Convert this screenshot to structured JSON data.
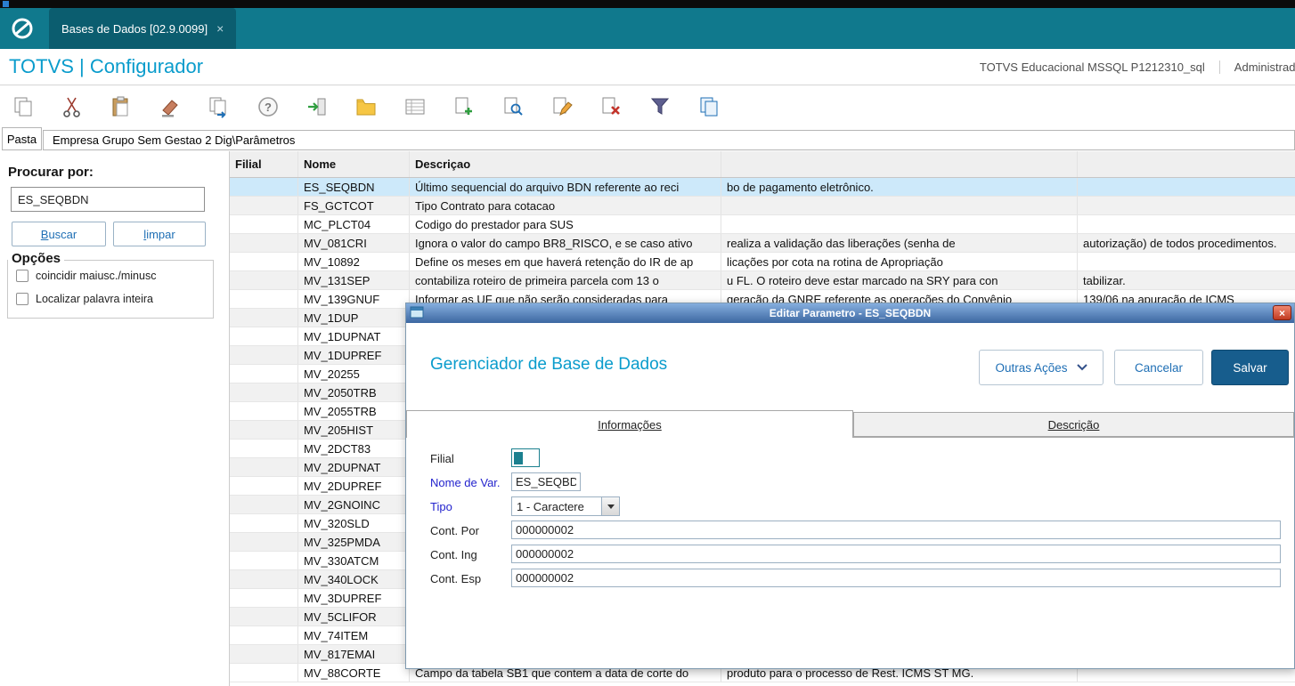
{
  "window": {
    "tab_title": "Bases de Dados [02.9.0099]",
    "tab_close": "×"
  },
  "header": {
    "title": "TOTVS | Configurador",
    "environment": "TOTVS Educacional MSSQL P1212310_sql",
    "user": "Administrador"
  },
  "toolbar": {
    "icons": [
      "copy",
      "cut",
      "paste",
      "eraser",
      "send",
      "help",
      "enter",
      "folder",
      "table",
      "add-record",
      "view",
      "edit",
      "delete-record",
      "filter",
      "duplicate"
    ]
  },
  "pasta": {
    "label": "Pasta",
    "path": "Empresa Grupo Sem Gestao 2 Dig\\Parâmetros"
  },
  "search_panel": {
    "title": "Procurar por:",
    "value": "ES_SEQBDN",
    "buscar": "Buscar",
    "limpar": "limpar",
    "options_title": "Opções",
    "options": [
      {
        "label": "coincidir maiusc./minusc",
        "checked": false
      },
      {
        "label": "Localizar palavra inteira",
        "checked": false
      }
    ]
  },
  "table": {
    "columns": [
      "Filial",
      "Nome",
      "Descriçao"
    ],
    "rows": [
      {
        "filial": "",
        "nome": "ES_SEQBDN",
        "d1": "Último sequencial do arquivo BDN referente ao reci",
        "d2": "bo de pagamento eletrônico.",
        "d3": "",
        "selected": true
      },
      {
        "filial": "",
        "nome": "FS_GCTCOT",
        "d1": "Tipo Contrato para cotacao",
        "d2": "",
        "d3": ""
      },
      {
        "filial": "",
        "nome": "MC_PLCT04",
        "d1": "Codigo do prestador para SUS",
        "d2": "",
        "d3": ""
      },
      {
        "filial": "",
        "nome": "MV_081CRI",
        "d1": "Ignora o valor do campo BR8_RISCO, e se caso ativo",
        "d2": "realiza a validação das liberações (senha de",
        "d3": "autorização) de todos procedimentos."
      },
      {
        "filial": "",
        "nome": "MV_10892",
        "d1": "Define os meses em que haverá retenção do IR de ap",
        "d2": "licações por cota na rotina de Apropriação",
        "d3": ""
      },
      {
        "filial": "",
        "nome": "MV_131SEP",
        "d1": "contabiliza roteiro de primeira parcela com 13 o",
        "d2": "u FL. O roteiro deve estar marcado na SRY para con",
        "d3": "tabilizar."
      },
      {
        "filial": "",
        "nome": "MV_139GNUF",
        "d1": "Informar as UF que não serão consideradas para",
        "d2": "geração da GNRE referente as operações do Convênio",
        "d3": "139/06 na apuração de ICMS"
      },
      {
        "filial": "",
        "nome": "MV_1DUP",
        "d1": "",
        "d2": "",
        "d3": ""
      },
      {
        "filial": "",
        "nome": "MV_1DUPNAT",
        "d1": "",
        "d2": "",
        "d3": ""
      },
      {
        "filial": "",
        "nome": "MV_1DUPREF",
        "d1": "",
        "d2": "",
        "d3": ""
      },
      {
        "filial": "",
        "nome": "MV_20255",
        "d1": "",
        "d2": "",
        "d3": ""
      },
      {
        "filial": "",
        "nome": "MV_2050TRB",
        "d1": "",
        "d2": "",
        "d3": ""
      },
      {
        "filial": "",
        "nome": "MV_2055TRB",
        "d1": "",
        "d2": "",
        "d3": ""
      },
      {
        "filial": "",
        "nome": "MV_205HIST",
        "d1": "",
        "d2": "",
        "d3": ""
      },
      {
        "filial": "",
        "nome": "MV_2DCT83",
        "d1": "",
        "d2": "",
        "d3": ""
      },
      {
        "filial": "",
        "nome": "MV_2DUPNAT",
        "d1": "",
        "d2": "",
        "d3": ""
      },
      {
        "filial": "",
        "nome": "MV_2DUPREF",
        "d1": "",
        "d2": "",
        "d3": ""
      },
      {
        "filial": "",
        "nome": "MV_2GNOINC",
        "d1": "",
        "d2": "",
        "d3": ""
      },
      {
        "filial": "",
        "nome": "MV_320SLD",
        "d1": "",
        "d2": "",
        "d3": ""
      },
      {
        "filial": "",
        "nome": "MV_325PMDA",
        "d1": "",
        "d2": "",
        "d3": ""
      },
      {
        "filial": "",
        "nome": "MV_330ATCM",
        "d1": "",
        "d2": "",
        "d3": ""
      },
      {
        "filial": "",
        "nome": "MV_340LOCK",
        "d1": "",
        "d2": "",
        "d3": ""
      },
      {
        "filial": "",
        "nome": "MV_3DUPREF",
        "d1": "",
        "d2": "",
        "d3": ""
      },
      {
        "filial": "",
        "nome": "MV_5CLIFOR",
        "d1": "",
        "d2": "",
        "d3": ""
      },
      {
        "filial": "",
        "nome": "MV_74ITEM",
        "d1": "",
        "d2": "",
        "d3": ""
      },
      {
        "filial": "",
        "nome": "MV_817EMAI",
        "d1": "",
        "d2": "",
        "d3": ""
      },
      {
        "filial": "",
        "nome": "MV_88CORTE",
        "d1": "Campo da tabela SB1 que contem a data de corte do",
        "d2": "produto para o processo de Rest. ICMS ST MG.",
        "d3": ""
      }
    ]
  },
  "dialog": {
    "title": "Editar Parametro - ES_SEQBDN",
    "heading": "Gerenciador de Base de Dados",
    "close": "×",
    "buttons": {
      "outras_acoes": "Outras Ações",
      "cancelar": "Cancelar",
      "salvar": "Salvar"
    },
    "tabs": [
      "Informações",
      "Descrição"
    ],
    "fields": {
      "filial_label": "Filial",
      "filial_value": "",
      "nome_label": "Nome de Var.",
      "nome_value": "ES_SEQBDN",
      "tipo_label": "Tipo",
      "tipo_value": "1 - Caractere",
      "cont_por_label": "Cont. Por",
      "cont_por_value": "000000002",
      "cont_ing_label": "Cont. Ing",
      "cont_ing_value": "000000002",
      "cont_esp_label": "Cont. Esp",
      "cont_esp_value": "000000002"
    }
  }
}
